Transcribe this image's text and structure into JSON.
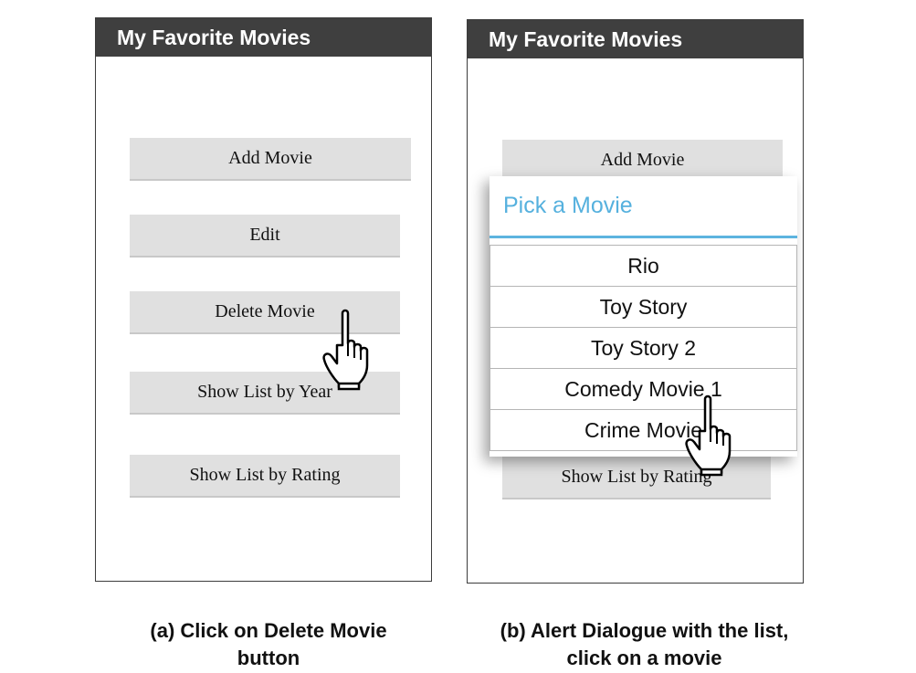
{
  "screen_a": {
    "title": "My Favorite Movies",
    "buttons": {
      "add_movie": "Add Movie",
      "edit": "Edit",
      "delete_movie": "Delete Movie",
      "show_by_year": "Show List by Year",
      "show_by_rating": "Show List by Rating"
    },
    "caption_line1": "(a) Click on Delete Movie",
    "caption_line2": "button"
  },
  "screen_b": {
    "title": "My Favorite Movies",
    "buttons": {
      "add_movie": "Add Movie",
      "show_by_rating": "Show List by Rating"
    },
    "dialog": {
      "title": "Pick a Movie",
      "items": [
        "Rio",
        "Toy Story",
        "Toy Story 2",
        "Comedy Movie 1",
        "Crime Movie"
      ]
    },
    "caption_line1": "(b) Alert Dialogue with the list,",
    "caption_line2": "click on a movie"
  },
  "colors": {
    "titlebar": "#3f3f3f",
    "button_bg": "#e0e0e0",
    "dialog_accent": "#56b1de"
  },
  "icons": [
    "pointing-hand-cursor-icon"
  ]
}
